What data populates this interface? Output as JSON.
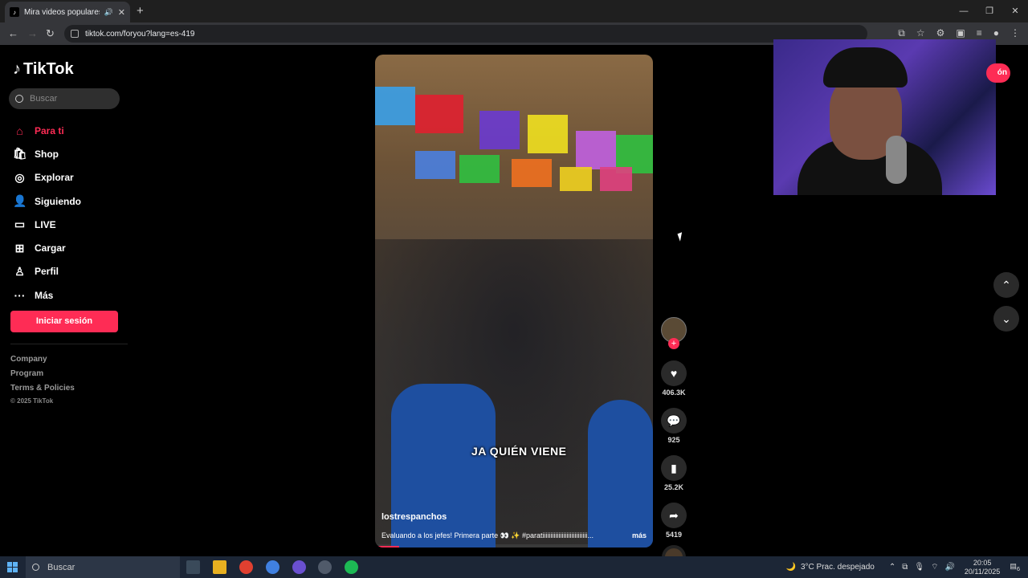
{
  "browser": {
    "tab_title": "Mira videos populares sele",
    "tab_favicon": "tiktok-icon",
    "url": "tiktok.com/foryou?lang=es-419"
  },
  "sidebar": {
    "logo": "TikTok",
    "search_placeholder": "Buscar",
    "items": [
      {
        "label": "Para ti",
        "icon": "home-icon"
      },
      {
        "label": "Shop",
        "icon": "shop-icon"
      },
      {
        "label": "Explorar",
        "icon": "compass-icon"
      },
      {
        "label": "Siguiendo",
        "icon": "following-icon"
      },
      {
        "label": "LIVE",
        "icon": "live-icon"
      },
      {
        "label": "Cargar",
        "icon": "upload-icon"
      },
      {
        "label": "Perfil",
        "icon": "profile-icon"
      },
      {
        "label": "Más",
        "icon": "more-icon"
      }
    ],
    "login_button": "Iniciar sesión",
    "footer": {
      "company": "Company",
      "program": "Program",
      "terms": "Terms & Policies",
      "copyright": "© 2025 TikTok"
    }
  },
  "video": {
    "caption_overlay": "JA QUIÉN VIENE",
    "username": "lostrespanchos",
    "description": "Evaluando a los jefes! Primera parte 👀 ✨ #paratiiiiiiiiiiiiiiiiiiiiiiiiiiii...",
    "more_label": "más",
    "likes": "406.3K",
    "comments": "925",
    "saves": "25.2K",
    "shares": "5419"
  },
  "header_right": {
    "login_partial": "ón"
  },
  "taskbar": {
    "search_placeholder": "Buscar",
    "weather": "3°C  Prac. despejado",
    "time": "20:05",
    "date": "20/11/2025",
    "notification_count": "6"
  },
  "colors": {
    "brand": "#fe2c55",
    "background": "#000000"
  }
}
